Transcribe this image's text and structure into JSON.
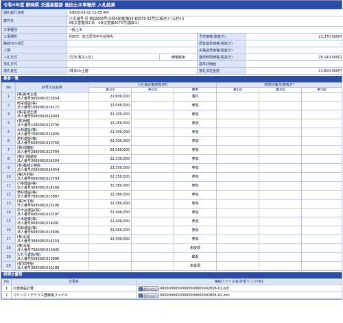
{
  "page_title": "令和4年度 静岡県 交通基盤部 島田土木事務所 入札結果",
  "summary": {
    "open_date_label": "開札執行日時",
    "open_date_value": "令和05-03-02 10:05 AM",
    "case_label": "案件名",
    "case_line1": "(入札番号:島 第22806号)令和4年度[第34-B3579-01号]二級河川 (大井川)",
    "case_line2": "4年災害復旧工事　4年災害第2575号(護岸工)",
    "category_label": "工事種別",
    "category_value": "一般土木",
    "location_label": "工事場所",
    "location_value": "島田市　町之原市字今谷地先",
    "district_label": "路線河川地区",
    "district_value": "",
    "period_label": "工期",
    "period_value": "",
    "method_label": "入札方式",
    "method_value": "(方法:電子入札)",
    "method_value2": "価格競争",
    "decision_label": "落札方式",
    "decision_value": "",
    "winner_label": "落札者名",
    "winner_value": "(株)鈴木土建",
    "right": [
      {
        "label": "予定価格(税抜き)",
        "value": "22,370,000円"
      },
      {
        "label": "調査基準価格(税抜き)",
        "value": "-"
      },
      {
        "label": "失格基準価格(税抜き)",
        "value": "-"
      },
      {
        "label": "最低制限価格(税抜き)",
        "value": "20,140,000円"
      },
      {
        "label": "基準評価値",
        "value": ""
      },
      {
        "label": "落札決定金額",
        "value": "21,800,000円"
      }
    ]
  },
  "bidders_section_title": "業者一覧",
  "bidders_header": {
    "no": "No",
    "name": "商号又は名称",
    "bid_group": "入札番記載金額(円)",
    "eval_group": "技術評価点(税抜き)",
    "r1": "第1回",
    "r2": "第2回",
    "remarks": "備考",
    "e1": "第1回",
    "e2": "第2回",
    "e3": "第3回"
  },
  "bidders": [
    {
      "no": "1",
      "name": "(株)鈴木土建",
      "corp": "法人番号9080001013654",
      "r1": "21,800,000",
      "r2": "",
      "remarks": "落札"
    },
    {
      "no": "2",
      "name": "総栄建設(株)",
      "corp": "法人番号1080001014172",
      "r1": "22,000,000",
      "r2": "",
      "remarks": "参加"
    },
    {
      "no": "3",
      "name": "(株)名波土建",
      "corp": "法人番号6080002014943",
      "r1": "22,200,000",
      "r2": "",
      "remarks": "参加"
    },
    {
      "no": "4",
      "name": "(株)明健",
      "corp": "法人番号1080001013736",
      "r1": "22,250,000",
      "r2": "",
      "remarks": "参加"
    },
    {
      "no": "5",
      "name": "大石建設(株)",
      "corp": "法人番号7080001013920",
      "r1": "22,300,000",
      "r2": "",
      "remarks": "参加"
    },
    {
      "no": "6",
      "name": "若杉建設(株)",
      "corp": "法人番号5080001013760",
      "r1": "22,300,000",
      "r2": "",
      "remarks": "参加"
    },
    {
      "no": "7",
      "name": "(株)加藤組",
      "corp": "法人番号2080001013784",
      "r1": "22,300,000",
      "r2": "",
      "remarks": "参加"
    },
    {
      "no": "8",
      "name": "(株)川崎建設",
      "corp": "法人番号3080001014204",
      "r1": "22,330,000",
      "r2": "",
      "remarks": "参加"
    },
    {
      "no": "9",
      "name": "(有)森崎工務店",
      "corp": "法人番号2080002014954",
      "r1": "22,350,000",
      "r2": "",
      "remarks": "参加"
    },
    {
      "no": "10",
      "name": "(株)木村組",
      "corp": "法人番号6080001013793",
      "r1": "22,350,000",
      "r2": "",
      "remarks": "参加"
    },
    {
      "no": "11",
      "name": "小栗建設(株)",
      "corp": "法人番号3080001014168",
      "r1": "22,360,000",
      "r2": "",
      "remarks": "参加"
    },
    {
      "no": "12",
      "name": "増井建設(株)",
      "corp": "法人番号7080001013887",
      "r1": "22,380,000",
      "r2": "",
      "remarks": "参加"
    },
    {
      "no": "13",
      "name": "(株)木下組",
      "corp": "法人番号6080001015106",
      "r1": "22,380,000",
      "r2": "",
      "remarks": "参加"
    },
    {
      "no": "14",
      "name": "杉十呂建設(株)",
      "corp": "法人番号6080001013797",
      "r1": "22,400,000",
      "r2": "",
      "remarks": "参加"
    },
    {
      "no": "15",
      "name": "八木産業(株)",
      "corp": "法人番号8080001014091",
      "r1": "22,400,000",
      "r2": "",
      "remarks": "参加"
    },
    {
      "no": "16",
      "name": "石松建設(株)",
      "corp": "法人番号6080001013696",
      "r1": "22,450,000",
      "r2": "",
      "remarks": "参加"
    },
    {
      "no": "17",
      "name": "(有)北道",
      "corp": "法人番号3080001014154",
      "r1": "22,500,000",
      "r2": "",
      "remarks": "参加"
    },
    {
      "no": "18",
      "name": "(株)青晴",
      "corp": "法人番号7080001013945",
      "r1": "",
      "r2": "",
      "remarks": "未受領"
    },
    {
      "no": "19",
      "name": "たむら建設(株)",
      "corp": "法人番号5080001013996",
      "r1": "",
      "r2": "",
      "remarks": "辞退"
    },
    {
      "no": "20",
      "name": "(有)田中組",
      "corp": "法人番号3080001015188",
      "r1": "",
      "r2": "",
      "remarks": "未受領"
    }
  ],
  "docs_section_title": "説明文書等",
  "docs_header": {
    "no": "No",
    "doc_name": "文書名",
    "file_name": "格納ファイル名/外部リンクURL"
  },
  "download_label": "ダウンロード",
  "docs": [
    {
      "no": "1",
      "name": "公表用設計書",
      "file": "00000000000000000000002806-01.pdf"
    },
    {
      "no": "2",
      "name": "コリンズ・テクリス登録用ファイル",
      "file": "00000000000000000000002806-02.xml"
    }
  ]
}
